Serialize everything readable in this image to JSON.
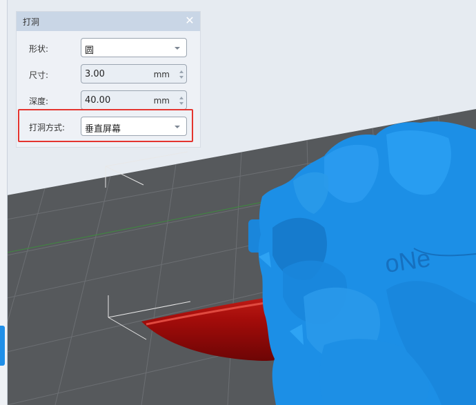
{
  "panel": {
    "title": "打洞",
    "close_icon": "close-icon",
    "fields": {
      "shape": {
        "label": "形状:",
        "value": "圆"
      },
      "size": {
        "label": "尺寸:",
        "value": "3.00",
        "unit": "mm"
      },
      "depth": {
        "label": "深度:",
        "value": "40.00",
        "unit": "mm"
      },
      "method": {
        "label": "打洞方式:",
        "value": "垂直屏幕"
      }
    }
  },
  "scene": {
    "model_text": "oNe",
    "colors": {
      "sky": "#e6ebf1",
      "floor": "#56595c",
      "model": "#1c8fe6",
      "cylinder": "#b8100d",
      "highlight": "#e4342e"
    }
  }
}
